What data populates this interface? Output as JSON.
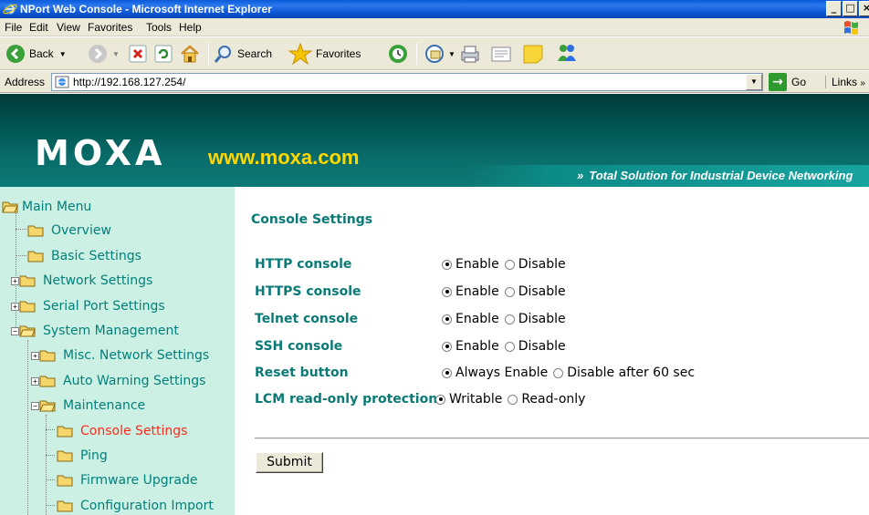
{
  "window": {
    "title": "NPort Web Console - Microsoft Internet Explorer",
    "min": "_",
    "max": "□",
    "close": "×"
  },
  "menu": [
    "File",
    "Edit",
    "View",
    "Favorites",
    "Tools",
    "Help"
  ],
  "toolbar": {
    "back": "Back",
    "search": "Search",
    "favorites": "Favorites"
  },
  "address": {
    "label": "Address",
    "url": "http://192.168.127.254/",
    "go": "Go",
    "links": "Links"
  },
  "banner": {
    "logo": "MOXA",
    "url": "www.moxa.com",
    "tagline": "Total Solution for Industrial Device Networking",
    "tagline_prefix": "»"
  },
  "sidebar": {
    "items": [
      {
        "label": "Main Menu",
        "state": "open"
      },
      {
        "label": "Overview",
        "state": "leaf"
      },
      {
        "label": "Basic Settings",
        "state": "leaf"
      },
      {
        "label": "Network Settings",
        "state": "collapsed"
      },
      {
        "label": "Serial Port Settings",
        "state": "collapsed"
      },
      {
        "label": "System Management",
        "state": "expanded"
      },
      {
        "label": "Misc. Network Settings",
        "state": "collapsed"
      },
      {
        "label": "Auto Warning Settings",
        "state": "collapsed"
      },
      {
        "label": "Maintenance",
        "state": "expanded"
      },
      {
        "label": "Console Settings",
        "state": "leaf",
        "active": true
      },
      {
        "label": "Ping",
        "state": "leaf"
      },
      {
        "label": "Firmware Upgrade",
        "state": "leaf"
      },
      {
        "label": "Configuration Import",
        "state": "leaf"
      }
    ]
  },
  "main": {
    "title": "Console Settings",
    "settings": [
      {
        "name": "HTTP console",
        "options": [
          "Enable",
          "Disable"
        ],
        "selected": 0
      },
      {
        "name": "HTTPS console",
        "options": [
          "Enable",
          "Disable"
        ],
        "selected": 0
      },
      {
        "name": "Telnet console",
        "options": [
          "Enable",
          "Disable"
        ],
        "selected": 0
      },
      {
        "name": "SSH console",
        "options": [
          "Enable",
          "Disable"
        ],
        "selected": 0
      },
      {
        "name": "Reset button",
        "options": [
          "Always Enable",
          "Disable after 60 sec"
        ],
        "selected": 0
      },
      {
        "name": "LCM read-only protection",
        "options": [
          "Writable",
          "Read-only"
        ],
        "selected": 0
      }
    ],
    "submit": "Submit"
  },
  "colors": {
    "accent": "#0a7a76",
    "sidebar_bg": "#ccf1e4",
    "active_link": "#ff2a1a",
    "banner_url": "#ffd800"
  }
}
